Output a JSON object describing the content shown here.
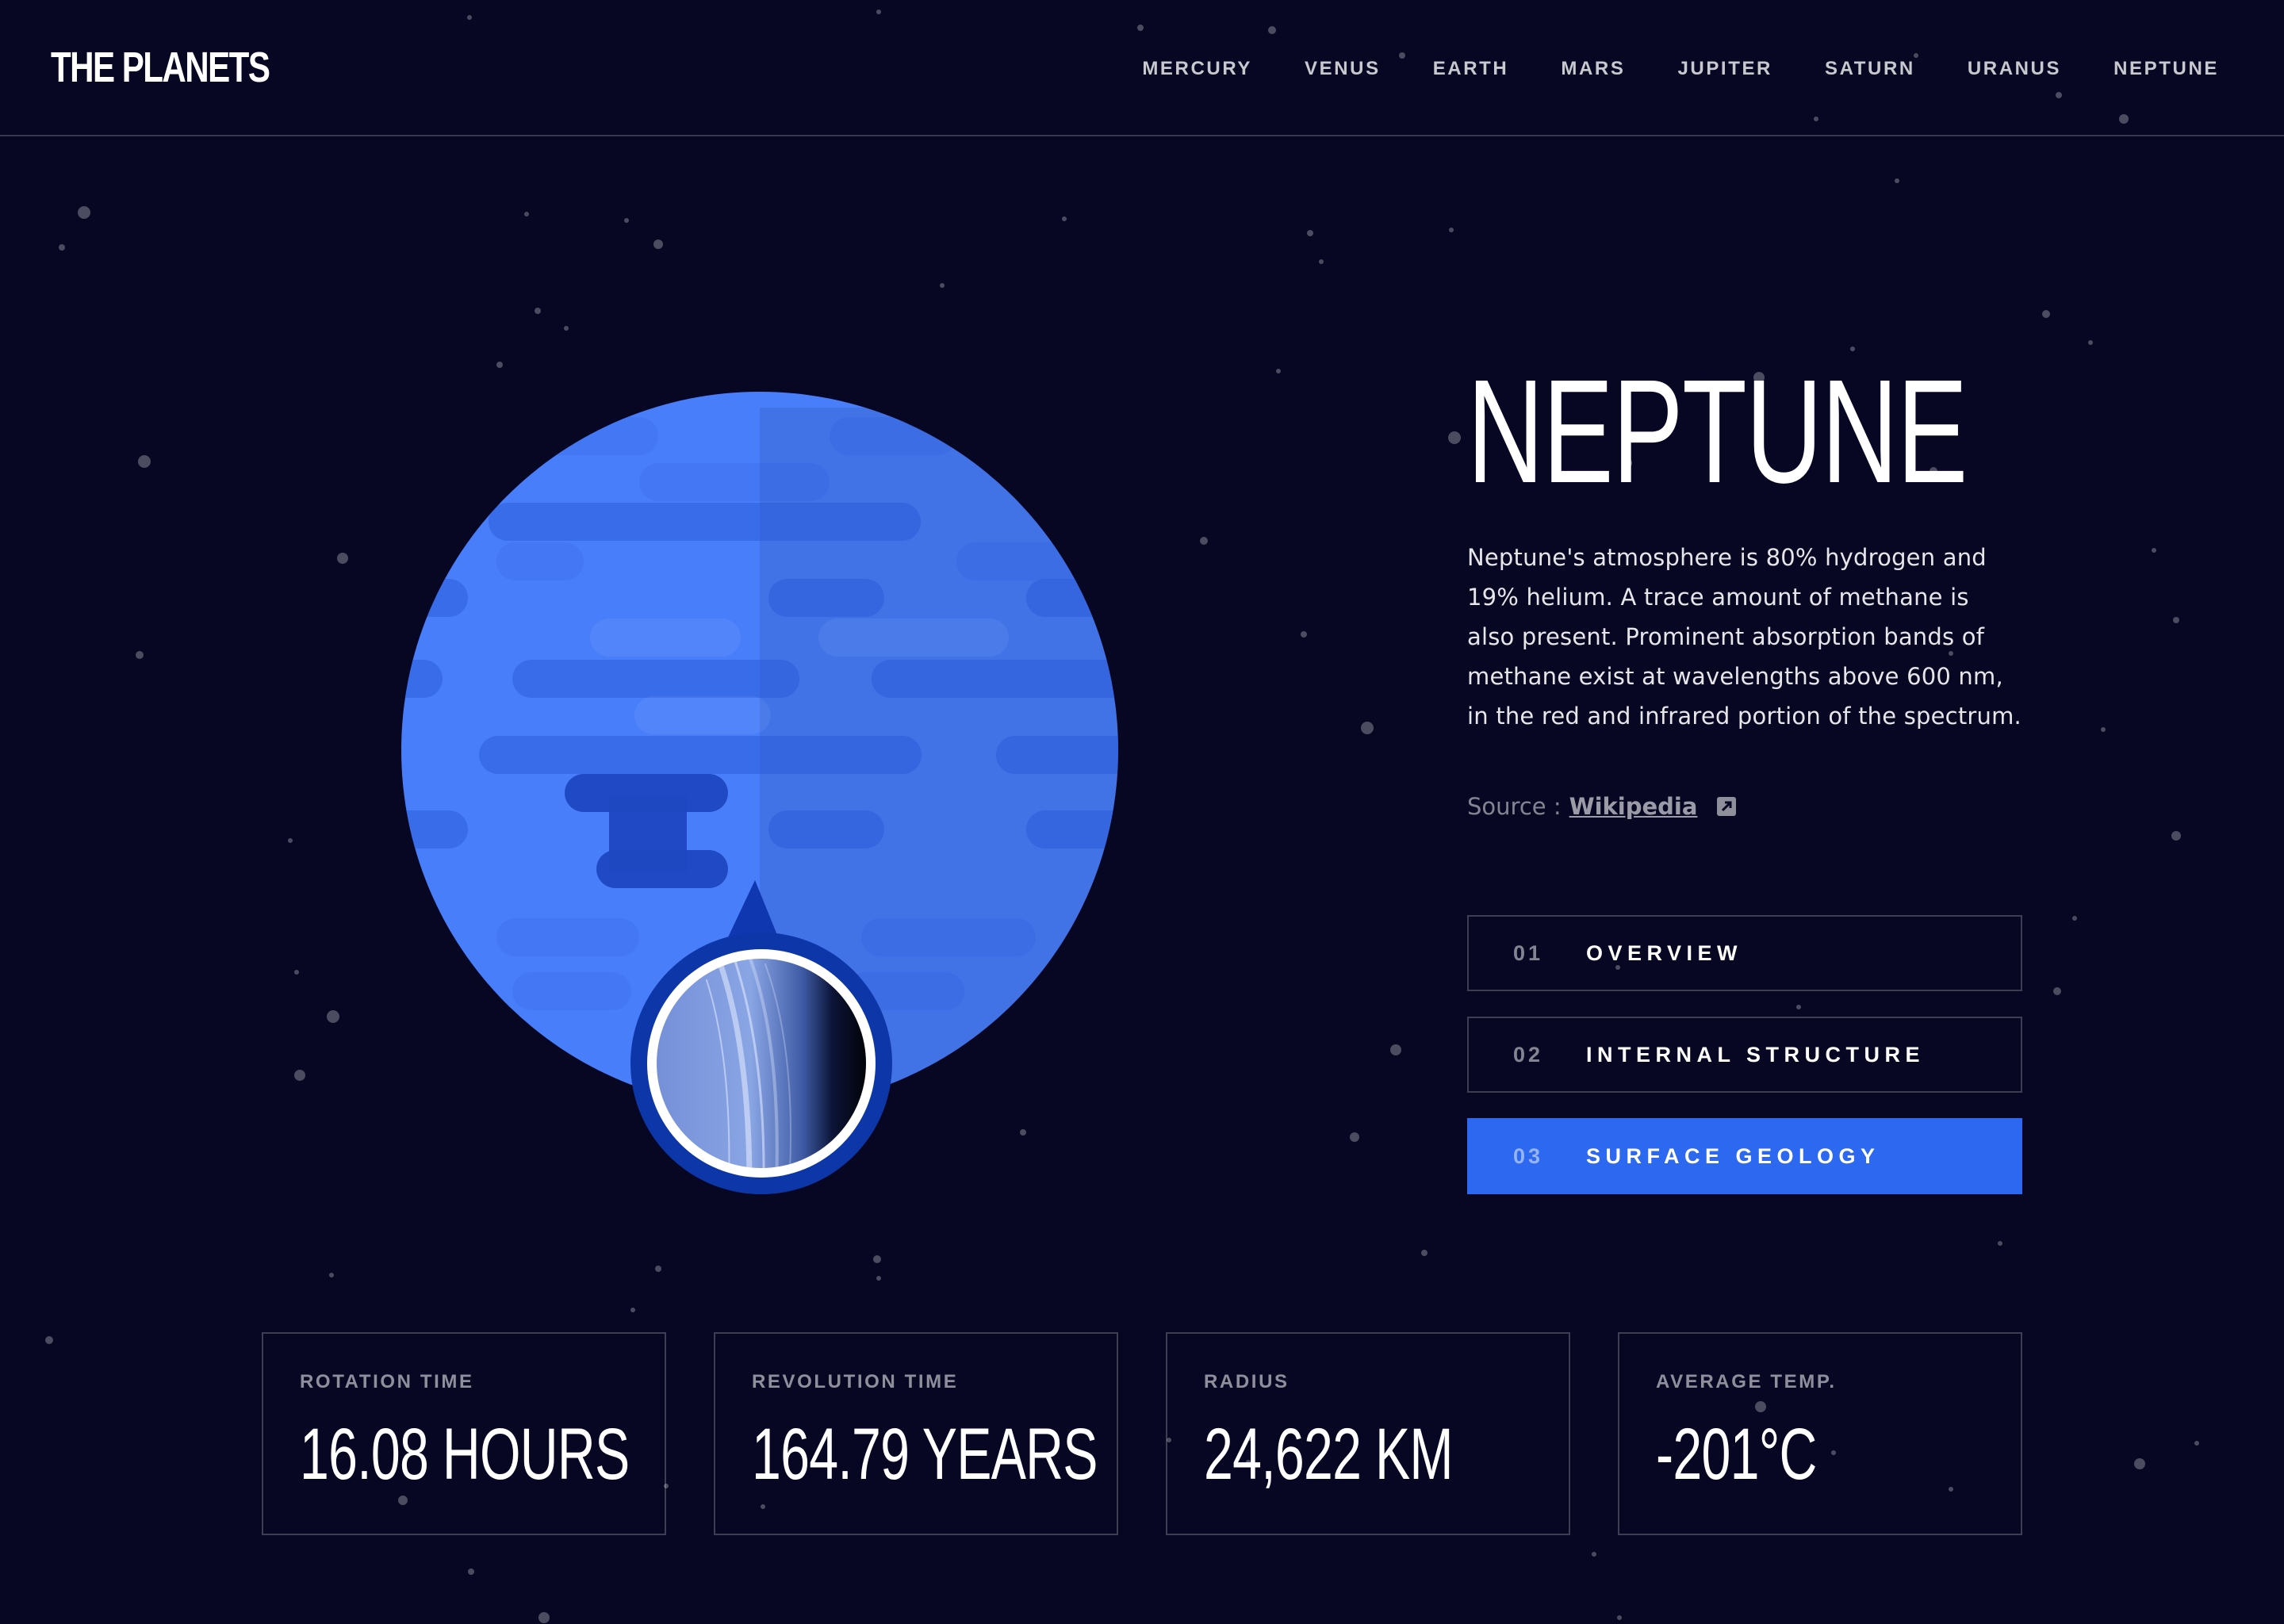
{
  "header": {
    "logo": "THE PLANETS",
    "nav": [
      "MERCURY",
      "VENUS",
      "EARTH",
      "MARS",
      "JUPITER",
      "SATURN",
      "URANUS",
      "NEPTUNE"
    ]
  },
  "planet": {
    "name": "NEPTUNE",
    "description": "Neptune's atmosphere is 80% hydrogen and 19% helium. A trace amount of methane is also present. Prominent absorption bands of methane exist at wavelengths above 600 nm, in the red and infrared portion of the spectrum.",
    "source_label": "Source :",
    "source_link": "Wikipedia"
  },
  "tabs": [
    {
      "num": "01",
      "label": "OVERVIEW"
    },
    {
      "num": "02",
      "label": "INTERNAL STRUCTURE"
    },
    {
      "num": "03",
      "label": "SURFACE GEOLOGY"
    }
  ],
  "active_tab": "03",
  "stats": [
    {
      "label": "ROTATION TIME",
      "value": "16.08 HOURS"
    },
    {
      "label": "REVOLUTION TIME",
      "value": "164.79 YEARS"
    },
    {
      "label": "RADIUS",
      "value": "24,622 KM"
    },
    {
      "label": "AVERAGE TEMP.",
      "value": "-201°C"
    }
  ],
  "colors": {
    "background": "#070724",
    "accent": "#2d68f0",
    "planet": "#497efa"
  }
}
